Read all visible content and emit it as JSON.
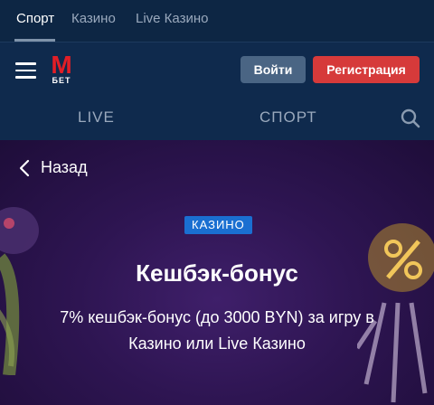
{
  "topnav": {
    "tabs": [
      {
        "label": "Спорт",
        "active": true
      },
      {
        "label": "Казино",
        "active": false
      },
      {
        "label": "Live Казино",
        "active": false
      }
    ]
  },
  "header": {
    "logo": {
      "letter": "M",
      "sub": "БЕТ"
    },
    "login_label": "Войти",
    "register_label": "Регистрация"
  },
  "mainnav": {
    "items": [
      {
        "label": "LIVE"
      },
      {
        "label": "СПОРТ"
      }
    ],
    "search_icon": "search-icon"
  },
  "promo": {
    "back_label": "Назад",
    "badge": "КАЗИНО",
    "title": "Кешбэк-бонус",
    "description": "7% кешбэк-бонус (до 3000 BYN) за игру в Казино или Live Казино"
  },
  "colors": {
    "brand_red": "#e21e26",
    "register_button": "#d63a3a",
    "login_button": "#4a6584",
    "badge": "#1a6fd1",
    "header_bg": "#0f2a4d"
  }
}
